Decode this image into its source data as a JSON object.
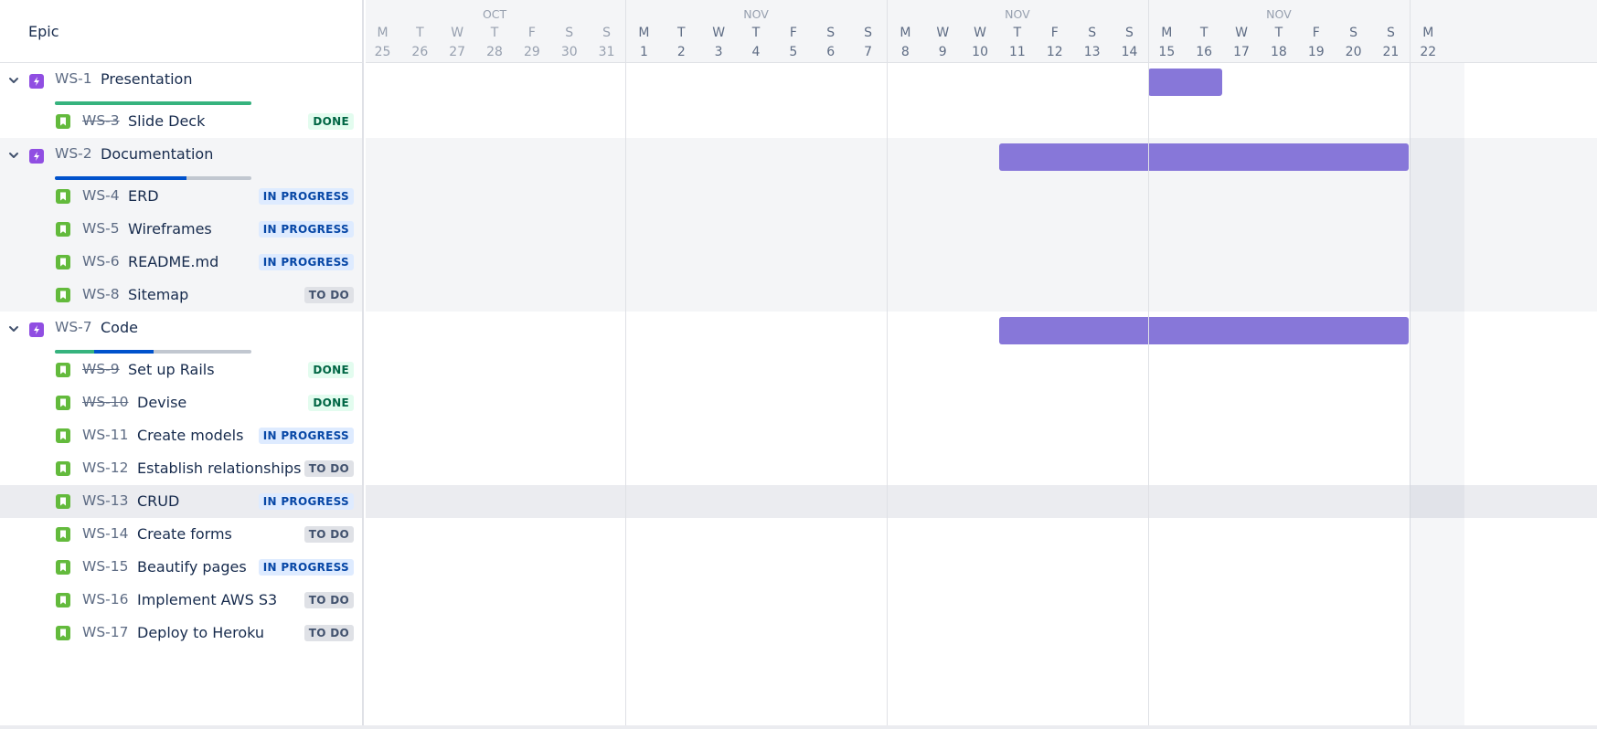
{
  "header": {
    "epic_label": "Epic"
  },
  "timeline": {
    "months": [
      "OCT",
      "NOV",
      "NOV",
      "NOV"
    ],
    "days": [
      {
        "dow": "M",
        "dom": "25",
        "past": true
      },
      {
        "dow": "T",
        "dom": "26",
        "past": true
      },
      {
        "dow": "W",
        "dom": "27",
        "past": true
      },
      {
        "dow": "T",
        "dom": "28",
        "past": true
      },
      {
        "dow": "F",
        "dom": "29",
        "past": true
      },
      {
        "dow": "S",
        "dom": "30",
        "past": true
      },
      {
        "dow": "S",
        "dom": "31",
        "past": true
      },
      {
        "dow": "M",
        "dom": "1"
      },
      {
        "dow": "T",
        "dom": "2"
      },
      {
        "dow": "W",
        "dom": "3"
      },
      {
        "dow": "T",
        "dom": "4"
      },
      {
        "dow": "F",
        "dom": "5"
      },
      {
        "dow": "S",
        "dom": "6"
      },
      {
        "dow": "S",
        "dom": "7"
      },
      {
        "dow": "M",
        "dom": "8"
      },
      {
        "dow": "W",
        "dom": "9"
      },
      {
        "dow": "W",
        "dom": "10"
      },
      {
        "dow": "T",
        "dom": "11"
      },
      {
        "dow": "F",
        "dom": "12"
      },
      {
        "dow": "S",
        "dom": "13"
      },
      {
        "dow": "S",
        "dom": "14"
      },
      {
        "dow": "M",
        "dom": "15"
      },
      {
        "dow": "T",
        "dom": "16"
      },
      {
        "dow": "W",
        "dom": "17"
      },
      {
        "dow": "T",
        "dom": "18"
      },
      {
        "dow": "F",
        "dom": "19"
      },
      {
        "dow": "S",
        "dom": "20"
      },
      {
        "dow": "S",
        "dom": "21"
      },
      {
        "dow": "M",
        "dom": "22"
      }
    ]
  },
  "epics": [
    {
      "key": "WS-1",
      "summary": "Presentation",
      "progress": {
        "done": 1.0,
        "inprogress": 0.0
      },
      "bar": {
        "start": "Nov 15",
        "end": "Nov 16"
      },
      "issues": [
        {
          "key": "WS-3",
          "summary": "Slide Deck",
          "status": "DONE",
          "status_kind": "done"
        }
      ]
    },
    {
      "key": "WS-2",
      "summary": "Documentation",
      "progress": {
        "done": 0.0,
        "inprogress": 0.67
      },
      "bar": {
        "start": "Nov 11",
        "end": "Nov 21"
      },
      "issues": [
        {
          "key": "WS-4",
          "summary": "ERD",
          "status": "IN PROGRESS",
          "status_kind": "inprogress"
        },
        {
          "key": "WS-5",
          "summary": "Wireframes",
          "status": "IN PROGRESS",
          "status_kind": "inprogress"
        },
        {
          "key": "WS-6",
          "summary": "README.md",
          "status": "IN PROGRESS",
          "status_kind": "inprogress"
        },
        {
          "key": "WS-8",
          "summary": "Sitemap",
          "status": "TO DO",
          "status_kind": "todo"
        }
      ]
    },
    {
      "key": "WS-7",
      "summary": "Code",
      "progress": {
        "done": 0.2,
        "inprogress": 0.3
      },
      "bar": {
        "start": "Nov 11",
        "end": "Nov 21"
      },
      "issues": [
        {
          "key": "WS-9",
          "summary": "Set up Rails",
          "status": "DONE",
          "status_kind": "done"
        },
        {
          "key": "WS-10",
          "summary": "Devise",
          "status": "DONE",
          "status_kind": "done"
        },
        {
          "key": "WS-11",
          "summary": "Create models",
          "status": "IN PROGRESS",
          "status_kind": "inprogress"
        },
        {
          "key": "WS-12",
          "summary": "Establish relationships",
          "status": "TO DO",
          "status_kind": "todo"
        },
        {
          "key": "WS-13",
          "summary": "CRUD",
          "status": "IN PROGRESS",
          "status_kind": "inprogress",
          "highlighted": true
        },
        {
          "key": "WS-14",
          "summary": "Create forms",
          "status": "TO DO",
          "status_kind": "todo"
        },
        {
          "key": "WS-15",
          "summary": "Beautify pages",
          "status": "IN PROGRESS",
          "status_kind": "inprogress"
        },
        {
          "key": "WS-16",
          "summary": "Implement AWS S3",
          "status": "TO DO",
          "status_kind": "todo"
        },
        {
          "key": "WS-17",
          "summary": "Deploy to Heroku",
          "status": "TO DO",
          "status_kind": "todo"
        }
      ]
    }
  ],
  "colors": {
    "epic_icon": "#904ee2",
    "story_icon": "#63ba3c",
    "bar": "#8777d9",
    "progress_done": "#36b37e",
    "progress_inprogress": "#0052cc",
    "progress_todo": "#c1c7d0"
  }
}
